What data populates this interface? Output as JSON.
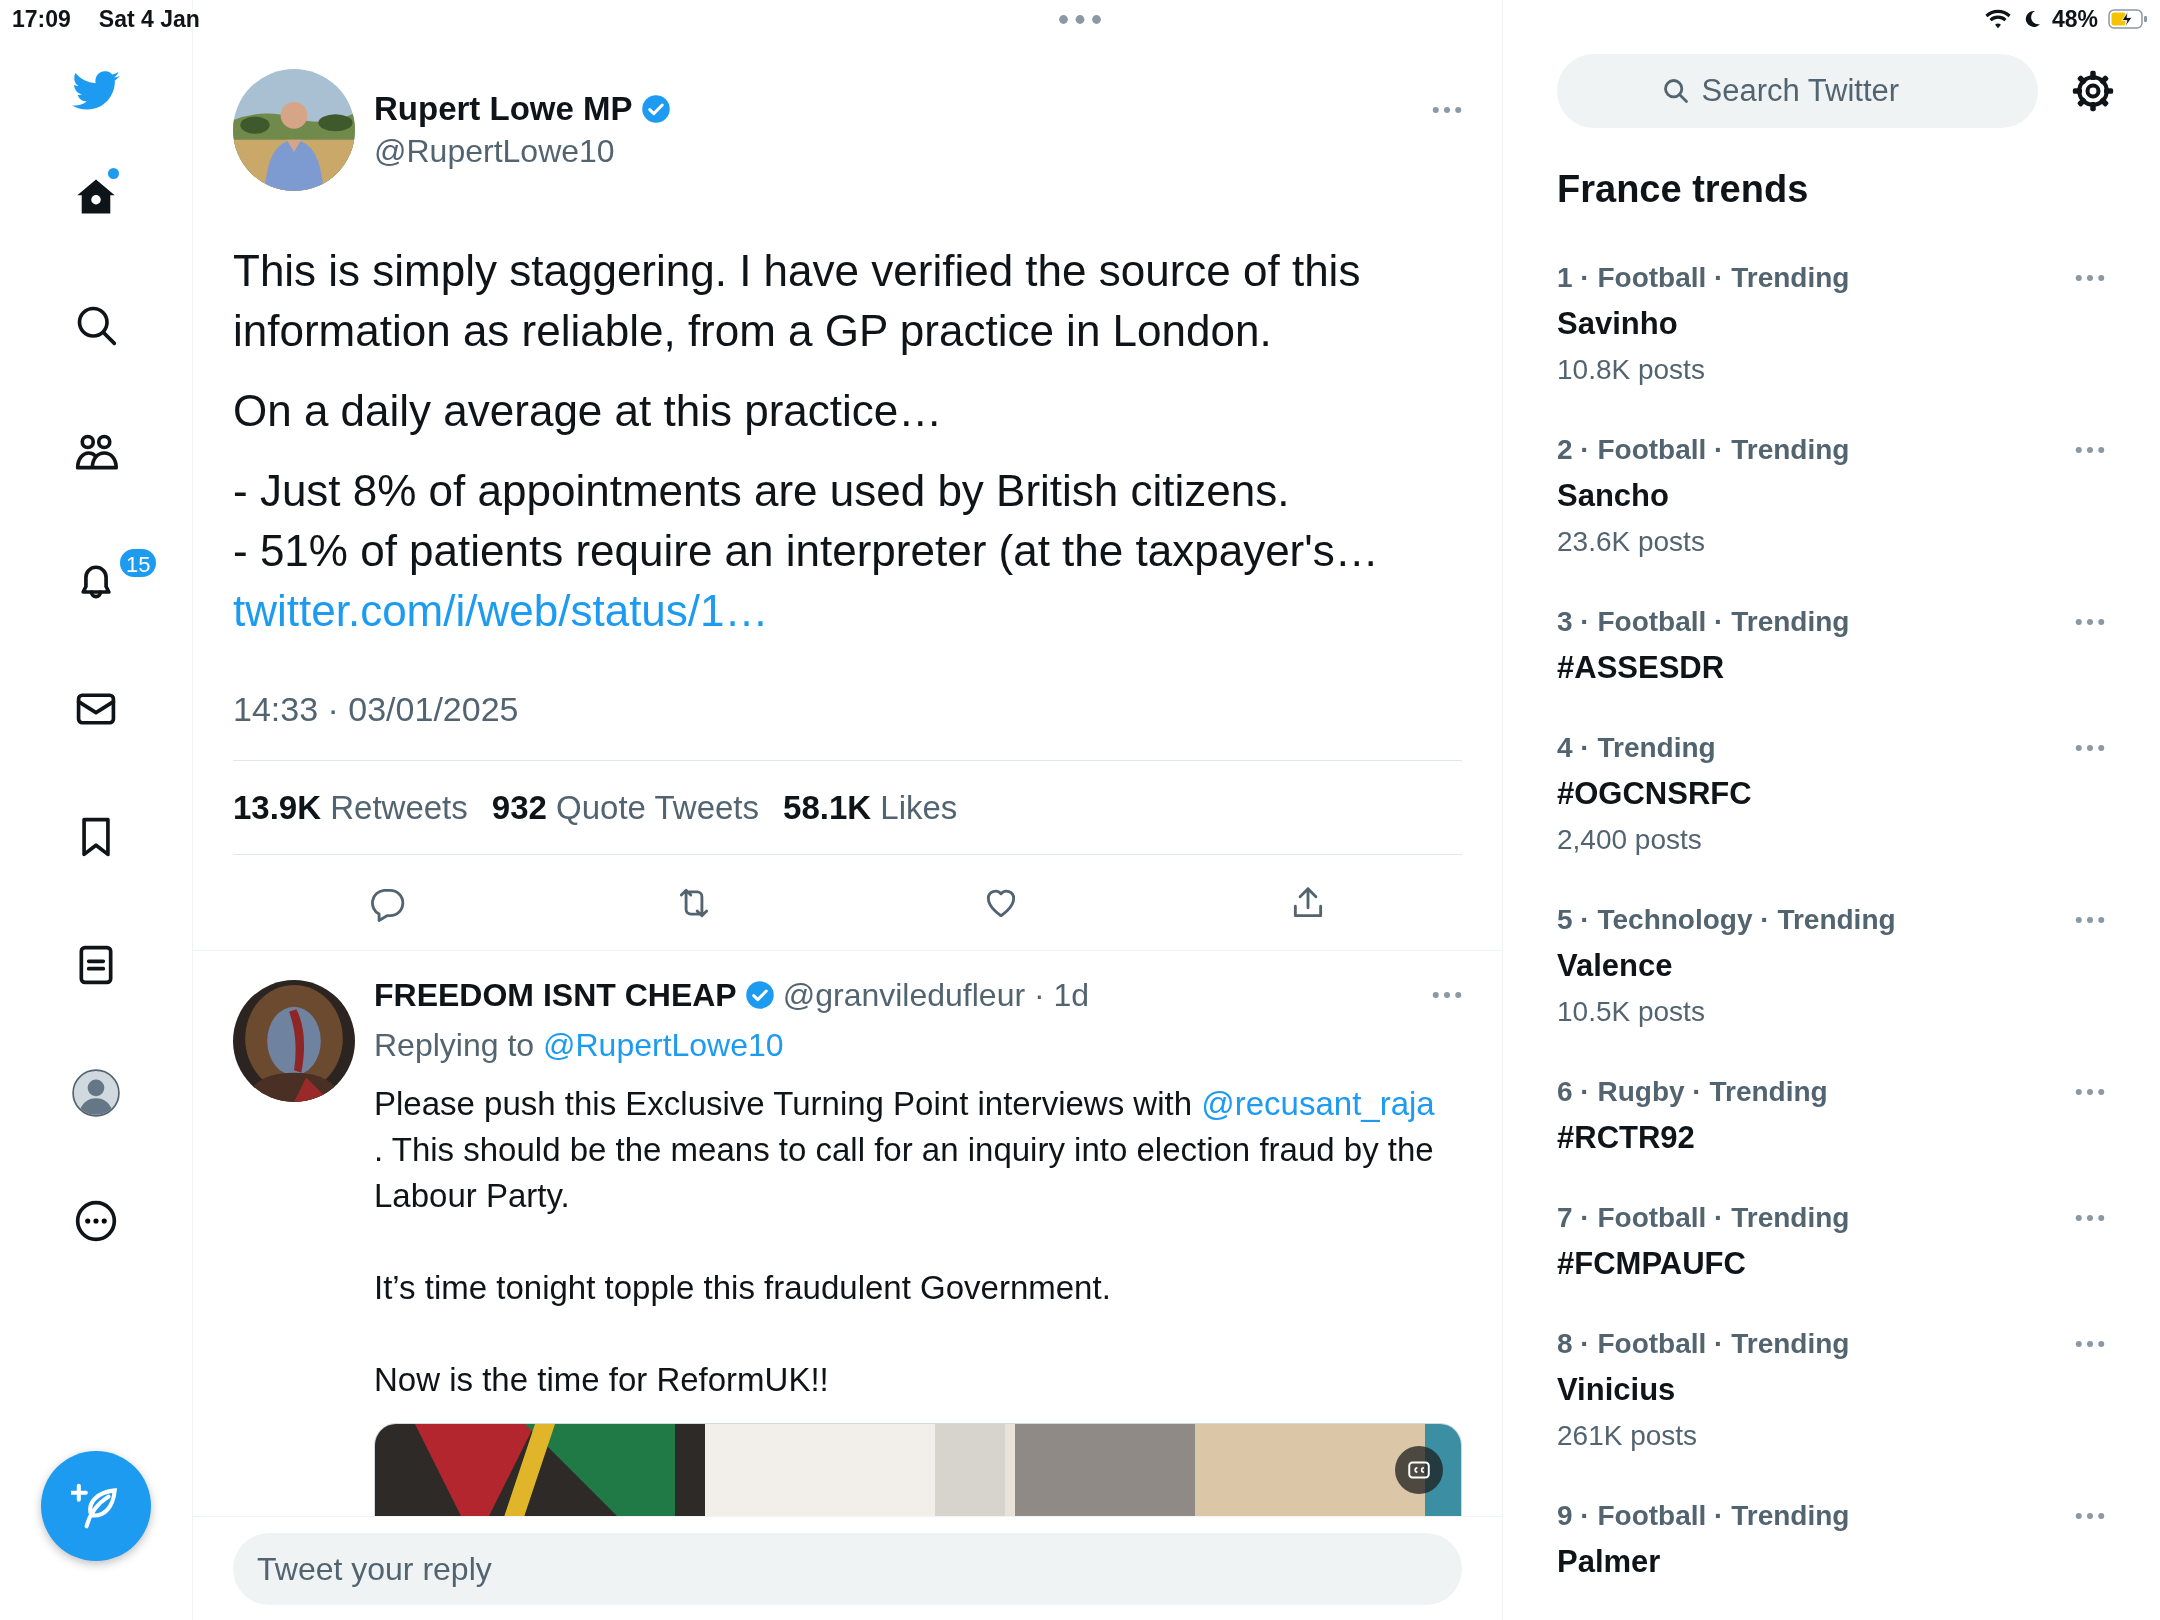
{
  "status_bar": {
    "time": "17:09",
    "date": "Sat 4 Jan",
    "battery_text": "48%",
    "charging": true
  },
  "sidebar": {
    "items": [
      {
        "kind": "home",
        "unread": true
      },
      {
        "kind": "explore",
        "unread": false
      },
      {
        "kind": "communities",
        "unread": false
      },
      {
        "kind": "notifications",
        "unread": false,
        "badge": "15"
      },
      {
        "kind": "messages",
        "unread": false
      },
      {
        "kind": "bookmarks",
        "unread": false
      },
      {
        "kind": "lists",
        "unread": false
      },
      {
        "kind": "profile",
        "unread": false
      },
      {
        "kind": "more",
        "unread": false
      }
    ]
  },
  "tweet": {
    "author": {
      "name": "Rupert Lowe MP",
      "handle": "@RupertLowe10",
      "verified": true
    },
    "paragraphs": [
      "This is simply staggering. I have verified the source of this information as reliable, from a GP practice in London.",
      "On a daily average at this practice…",
      "- Just 8% of appointments are used by British citizens.\n- 51% of patients require an interpreter (at the taxpayer's…"
    ],
    "link": "twitter.com/i/web/status/1…",
    "timestamp": "14:33 · 03/01/2025",
    "stats": [
      {
        "count": "13.9K",
        "label": "Retweets"
      },
      {
        "count": "932",
        "label": "Quote Tweets"
      },
      {
        "count": "58.1K",
        "label": "Likes"
      }
    ],
    "actions": [
      {
        "kind": "reply"
      },
      {
        "kind": "retweet"
      },
      {
        "kind": "like"
      },
      {
        "kind": "share"
      }
    ]
  },
  "reply": {
    "author": {
      "name": "FREEDOM ISNT CHEAP",
      "verified": true
    },
    "meta": "@granviledufleur · 1d",
    "replying_prefix": "Replying to",
    "replying_handle": "@RupertLowe10",
    "paragraphs": [
      [
        {
          "kind": "text",
          "text": "Please push this Exclusive Turning Point interviews with "
        },
        {
          "kind": "mention",
          "text": "@recusant_raja"
        },
        {
          "kind": "break"
        },
        {
          "kind": "text",
          "text": ". This should be the means to call for an inquiry into election fraud by the Labour Party."
        }
      ],
      [
        {
          "kind": "text",
          "text": "It’s time tonight topple this fraudulent Government."
        }
      ],
      [
        {
          "kind": "text",
          "text": "Now is the time for ReformUK!!"
        }
      ]
    ]
  },
  "reply_box": {
    "placeholder": "Tweet your reply"
  },
  "search": {
    "placeholder": "Search Twitter"
  },
  "trends": {
    "title": "France trends",
    "items": [
      {
        "meta": "1 · Football · Trending",
        "name": "Savinho",
        "posts": "10.8K posts"
      },
      {
        "meta": "2 · Football · Trending",
        "name": "Sancho",
        "posts": "23.6K posts"
      },
      {
        "meta": "3 · Football · Trending",
        "name": "#ASSESDR"
      },
      {
        "meta": "4 · Trending",
        "name": "#OGCNSRFC",
        "posts": "2,400 posts"
      },
      {
        "meta": "5 · Technology · Trending",
        "name": "Valence",
        "posts": "10.5K posts"
      },
      {
        "meta": "6 · Rugby · Trending",
        "name": "#RCTR92"
      },
      {
        "meta": "7 · Football · Trending",
        "name": "#FCMPAUFC"
      },
      {
        "meta": "8 · Football · Trending",
        "name": "Vinicius",
        "posts": "261K posts"
      },
      {
        "meta": "9 · Football · Trending",
        "name": "Palmer"
      }
    ]
  }
}
